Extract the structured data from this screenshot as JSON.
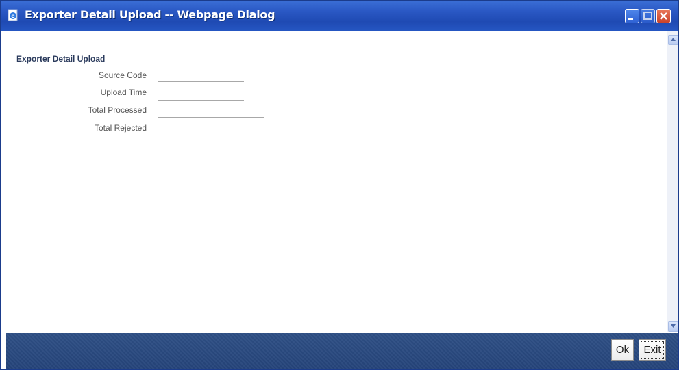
{
  "window": {
    "title": "Exporter Detail Upload -- Webpage Dialog"
  },
  "form": {
    "legend": "Exporter Detail Upload",
    "fields": [
      {
        "label": "Source Code",
        "value": ""
      },
      {
        "label": "Upload Time",
        "value": ""
      },
      {
        "label": "Total Processed",
        "value": ""
      },
      {
        "label": "Total Rejected",
        "value": ""
      }
    ]
  },
  "footer": {
    "ok_label": "Ok",
    "exit_label": "Exit"
  },
  "colors": {
    "titlebar": "#2a58c4",
    "footer": "#2e4f85",
    "legend_text": "#2a3a5c"
  }
}
